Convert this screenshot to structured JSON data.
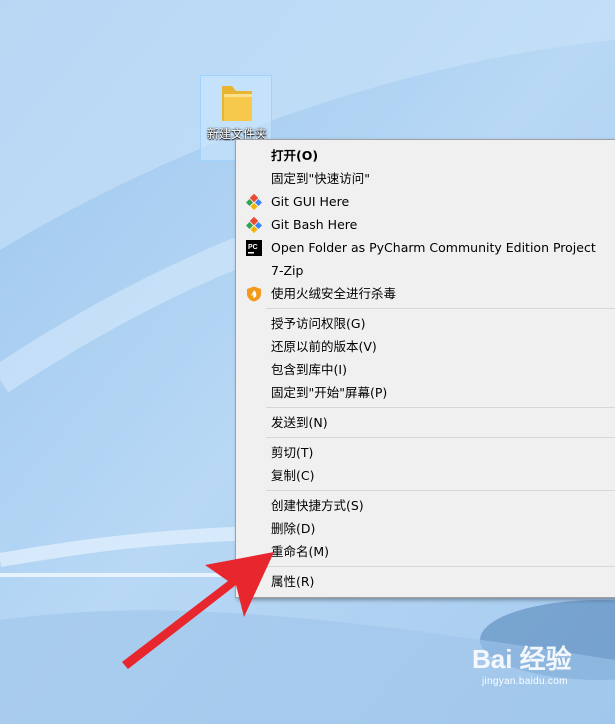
{
  "desktop": {
    "folder_label": "新建文件夹"
  },
  "context_menu": {
    "items": [
      {
        "label": "打开(O)",
        "icon": "none"
      },
      {
        "label": "固定到\"快速访问\"",
        "icon": "none"
      },
      {
        "label": "Git GUI Here",
        "icon": "git-icon"
      },
      {
        "label": "Git Bash Here",
        "icon": "git-icon"
      },
      {
        "label": "Open Folder as PyCharm Community Edition Project",
        "icon": "pycharm-icon"
      },
      {
        "label": "7-Zip",
        "icon": "none"
      },
      {
        "label": "使用火绒安全进行杀毒",
        "icon": "huorong-shield-icon"
      },
      {
        "label": "授予访问权限(G)",
        "icon": "none"
      },
      {
        "label": "还原以前的版本(V)",
        "icon": "none"
      },
      {
        "label": "包含到库中(I)",
        "icon": "none"
      },
      {
        "label": "固定到\"开始\"屏幕(P)",
        "icon": "none"
      },
      {
        "label": "发送到(N)",
        "icon": "none"
      },
      {
        "label": "剪切(T)",
        "icon": "none"
      },
      {
        "label": "复制(C)",
        "icon": "none"
      },
      {
        "label": "创建快捷方式(S)",
        "icon": "none"
      },
      {
        "label": "删除(D)",
        "icon": "none"
      },
      {
        "label": "重命名(M)",
        "icon": "none"
      },
      {
        "label": "属性(R)",
        "icon": "none"
      }
    ]
  },
  "pycharm_icon_text": "PC",
  "watermark": {
    "brand": "Bai 经验",
    "site": "jingyan.baidu.com"
  },
  "colors": {
    "wallpaper": "#aed0f1",
    "menu_bg": "#f0f0f0",
    "arrow": "#e8262e",
    "folder": "#f6c94c"
  }
}
